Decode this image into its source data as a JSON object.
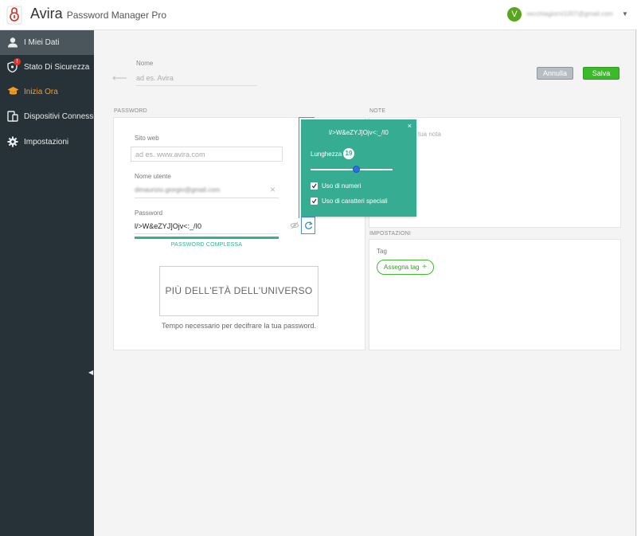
{
  "app": {
    "brand_name": "Avira",
    "brand_product": "Password Manager Pro",
    "user_initial": "V",
    "user_email": "vecchiagiorni1007@gmail.com"
  },
  "sidebar": {
    "items": [
      {
        "label": "I Miei Dati",
        "icon": "user-icon",
        "active": true
      },
      {
        "label": "Stato Di Sicurezza",
        "icon": "shield-icon",
        "badge": "!"
      },
      {
        "label": "Inizia Ora",
        "icon": "graduation-cap-icon",
        "highlight": "#f29c24"
      },
      {
        "label": "Dispositivi Connessi",
        "icon": "devices-icon"
      },
      {
        "label": "Impostazioni",
        "icon": "gear-icon"
      }
    ]
  },
  "header": {
    "name_label": "Nome",
    "name_placeholder": "ad es. Avira",
    "cancel_label": "Annulla",
    "save_label": "Salva"
  },
  "password_section": {
    "title": "PASSWORD",
    "website_label": "Sito web",
    "website_placeholder": "ad es. www.avira.com",
    "username_label": "Nome utente",
    "username_value": "dimaurizio.giorgio@gmail.com",
    "password_label": "Password",
    "password_value": "l/>W&eZYJ]Ojv<:_/I0",
    "strength_label": "PASSWORD COMPLESSA",
    "crack_time": "PIÙ DELL'ETÀ DELL'UNIVERSO",
    "crack_caption": "Tempo necessario per decifrare la tua password."
  },
  "notes_section": {
    "title": "NOTE",
    "placeholder": "tua nota"
  },
  "settings_section": {
    "title": "IMPOSTAZIONI",
    "tag_label": "Tag",
    "assign_tag_label": "Assegna tag",
    "assign_tag_plus": "+"
  },
  "generator": {
    "close": "×",
    "generated_password": "l/>W&eZYJ]Ojv<:_/I0",
    "length_label": "Lunghezza",
    "length_value": "19",
    "length_fraction": 0.56,
    "use_numbers_label": "Uso di numeri",
    "use_numbers": true,
    "use_special_label": "Uso di caratteri speciali",
    "use_special": true
  },
  "colors": {
    "accent_green": "#3bbb2a",
    "generator_bg": "#36ad93",
    "sidebar_bg": "#273238",
    "strength": "#34b28f"
  }
}
